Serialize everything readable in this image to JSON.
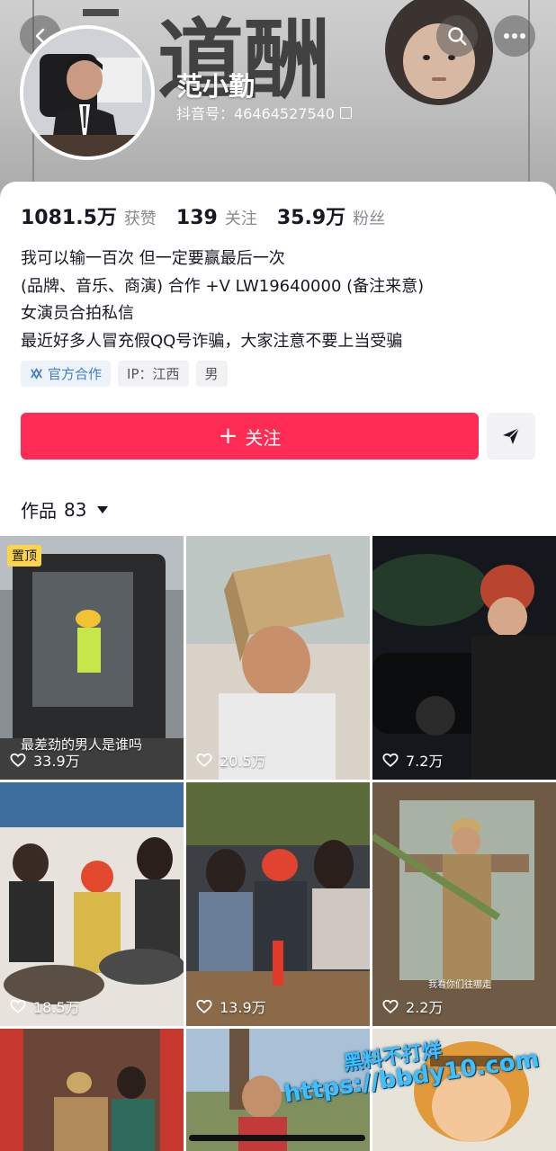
{
  "header": {
    "nickname": "范小勤",
    "douyin_id": "抖音号：46464527540",
    "banner_calligraphy": "道酬"
  },
  "icons": {
    "back": "back-arrow-icon",
    "search": "search-icon",
    "more": "more-dots-icon",
    "copy": "copy-icon",
    "send": "send-icon",
    "heart": "heart-outline-icon",
    "official": "official-partner-icon"
  },
  "stats": [
    {
      "value": "1081.5万",
      "label": "获赞"
    },
    {
      "value": "139",
      "label": "关注"
    },
    {
      "value": "35.9万",
      "label": "粉丝"
    }
  ],
  "bio": [
    "我可以输一百次 但一定要赢最后一次",
    "(品牌、音乐、商演) 合作 +V    LW19640000 (备注来意)",
    "女演员合拍私信",
    "最近好多人冒充假QQ号诈骗，大家注意不要上当受骗"
  ],
  "tags": {
    "official": "官方合作",
    "ip": "IP：江西",
    "gender": "男"
  },
  "actions": {
    "follow_plus": "+",
    "follow_label": "关注"
  },
  "works": {
    "label": "作品",
    "count": "83"
  },
  "videos": [
    {
      "likes": "33.9万",
      "caption": "最差劲的男人是谁吗",
      "pinned": "置顶"
    },
    {
      "likes": "20.5万",
      "caption": "",
      "pinned": ""
    },
    {
      "likes": "7.2万",
      "caption": "",
      "pinned": ""
    },
    {
      "likes": "18.5万",
      "caption": "",
      "pinned": ""
    },
    {
      "likes": "13.9万",
      "caption": "",
      "pinned": ""
    },
    {
      "likes": "2.2万",
      "caption": "我看你们往哪走",
      "pinned": ""
    },
    {
      "likes": "",
      "caption": "",
      "pinned": ""
    },
    {
      "likes": "",
      "caption": "",
      "pinned": ""
    },
    {
      "likes": "",
      "caption": "",
      "pinned": ""
    }
  ],
  "watermark": {
    "line1": "黑料不打烊",
    "line2": "https://bbdy10.com"
  },
  "colors": {
    "follow_button": "#fe2c55",
    "official_tag_text": "#3d7fc7",
    "pin_badge": "#fcd34d",
    "watermark": "#3ec0ff"
  }
}
